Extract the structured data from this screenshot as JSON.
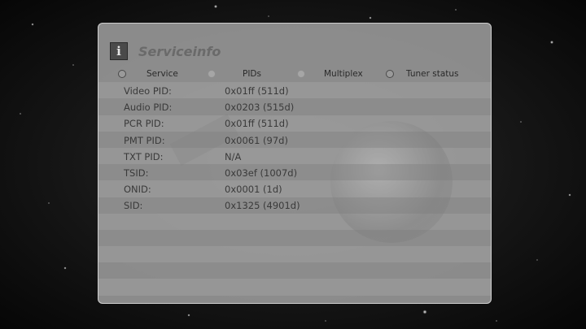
{
  "header": {
    "title": "Serviceinfo",
    "icon": "info-icon"
  },
  "tabs": [
    {
      "label": "Service",
      "selected": false
    },
    {
      "label": "PIDs",
      "selected": true
    },
    {
      "label": "Multiplex",
      "selected": false
    },
    {
      "label": "Tuner status",
      "selected": false
    }
  ],
  "rows": [
    {
      "label": "Video PID:",
      "value": "0x01ff (511d)"
    },
    {
      "label": "Audio PID:",
      "value": "0x0203 (515d)"
    },
    {
      "label": "PCR PID:",
      "value": "0x01ff (511d)"
    },
    {
      "label": "PMT PID:",
      "value": "0x0061 (97d)"
    },
    {
      "label": "TXT PID:",
      "value": "N/A"
    },
    {
      "label": "TSID:",
      "value": "0x03ef (1007d)"
    },
    {
      "label": "ONID:",
      "value": "0x0001 (1d)"
    },
    {
      "label": "SID:",
      "value": "0x1325 (4901d)"
    }
  ]
}
